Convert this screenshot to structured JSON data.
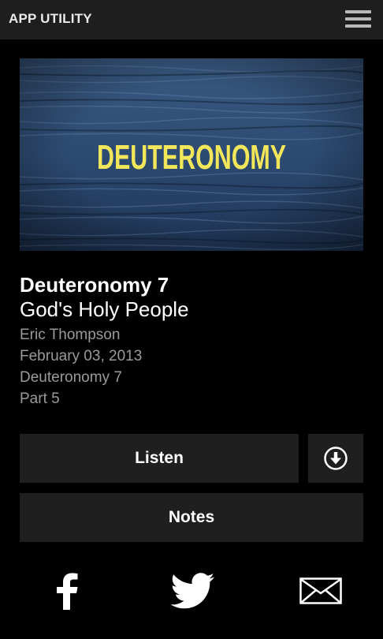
{
  "header": {
    "app_title": "APP UTILITY",
    "menu_icon": "hamburger-menu-icon"
  },
  "artwork": {
    "text": "DEUTERONOMY",
    "text_color": "#f2e65a",
    "background_color": "#2c4a6e"
  },
  "sermon": {
    "title": "Deuteronomy 7",
    "subtitle": "God's Holy People",
    "speaker": "Eric Thompson",
    "date": "February 03, 2013",
    "series": "Deuteronomy 7",
    "part": "Part 5"
  },
  "actions": {
    "listen_label": "Listen",
    "download_icon": "download-circle-icon",
    "notes_label": "Notes"
  },
  "share": {
    "icons": [
      "facebook-icon",
      "twitter-icon",
      "email-icon"
    ]
  },
  "colors": {
    "background": "#000000",
    "topbar": "#1e1e1e",
    "button": "#1f1f1f",
    "meta_text": "#9a9a9a"
  }
}
